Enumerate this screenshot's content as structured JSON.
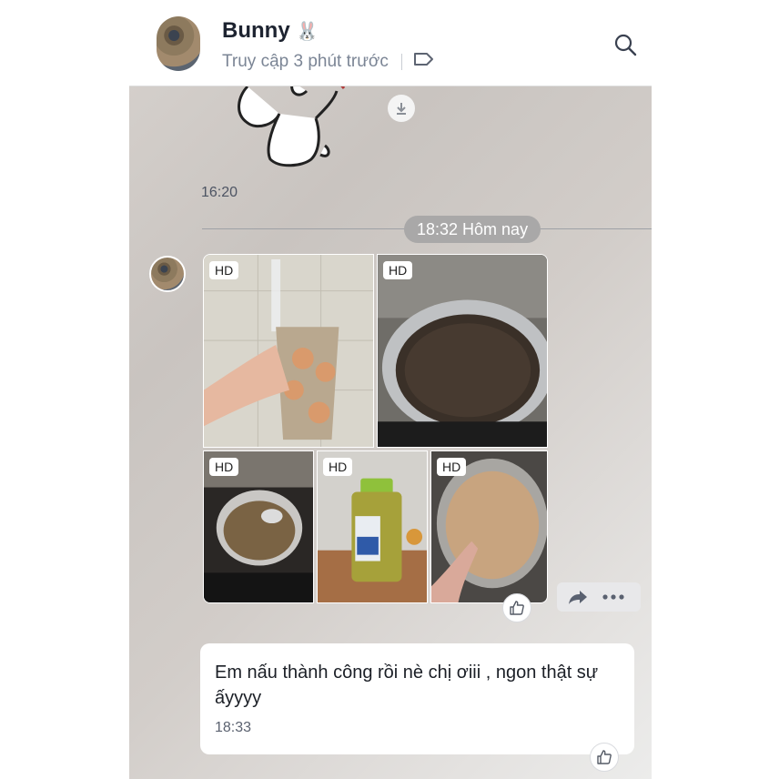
{
  "header": {
    "contact_name": "Bunny",
    "contact_emoji": "🐰",
    "status": "Truy cập 3 phút trước",
    "icons": [
      "tag-icon",
      "search-icon"
    ]
  },
  "messages": {
    "sticker_time": "16:20",
    "date_separator": "18:32 Hôm nay",
    "photos": [
      {
        "badge": "HD",
        "subject": "cup"
      },
      {
        "badge": "HD",
        "subject": "pot"
      },
      {
        "badge": "HD",
        "subject": "boiling-pot"
      },
      {
        "badge": "HD",
        "subject": "bottle"
      },
      {
        "badge": "HD",
        "subject": "milk-tea-pan"
      }
    ],
    "text_message": {
      "text": "Em nấu thành công rồi nè chị ơiii , ngon thật sự ấyyyy",
      "time": "18:33"
    }
  },
  "colors": {
    "header_bg": "#ffffff",
    "bubble_bg": "#ffffff",
    "date_pill": "#a9a8a8",
    "title_text": "#1d2330"
  }
}
